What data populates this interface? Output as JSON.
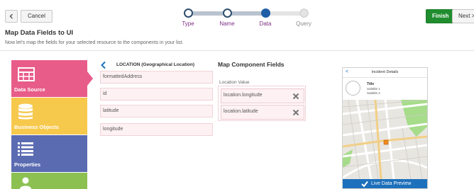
{
  "toolbar": {
    "cancel_label": "Cancel",
    "finish_label": "Finish",
    "next_label": "Next >"
  },
  "train": {
    "steps": [
      {
        "label": "Type",
        "state": "visited"
      },
      {
        "label": "Name",
        "state": "visited"
      },
      {
        "label": "Data",
        "state": "current"
      },
      {
        "label": "Query",
        "state": "disabled"
      }
    ]
  },
  "page": {
    "title": "Map Data Fields to UI",
    "subtitle": "Now let's map the fields for your selected resource to the components in your list."
  },
  "palette": {
    "items": [
      {
        "label": "Data Source",
        "color": "#e85c8a",
        "icon": "table-icon"
      },
      {
        "label": "Business Objects",
        "color": "#f6c84c",
        "icon": "database-icon"
      },
      {
        "label": "Properties",
        "color": "#5b6bb2",
        "icon": "list-icon"
      },
      {
        "label": "",
        "color": "#8cc152",
        "icon": "user-icon"
      }
    ]
  },
  "location": {
    "title": "LOCATION (Geographical Location)",
    "fields": [
      "formattedAddress",
      "id",
      "latitude",
      "longitude"
    ]
  },
  "mapping": {
    "title": "Map Component Fields",
    "value_label": "Location Value",
    "values": [
      "location.longitude",
      "location.latitude"
    ]
  },
  "preview": {
    "header": "Incident Details",
    "title": "Title",
    "subtitle1": "Subtitle 1",
    "subtitle2": "Subtitle 2",
    "live_label": "Live Data Preview"
  },
  "colors": {
    "accent_blue": "#1d70bb",
    "finish_green": "#208d2e",
    "train_purple": "#7e2e84",
    "field_pink": "#fdf1f3"
  }
}
